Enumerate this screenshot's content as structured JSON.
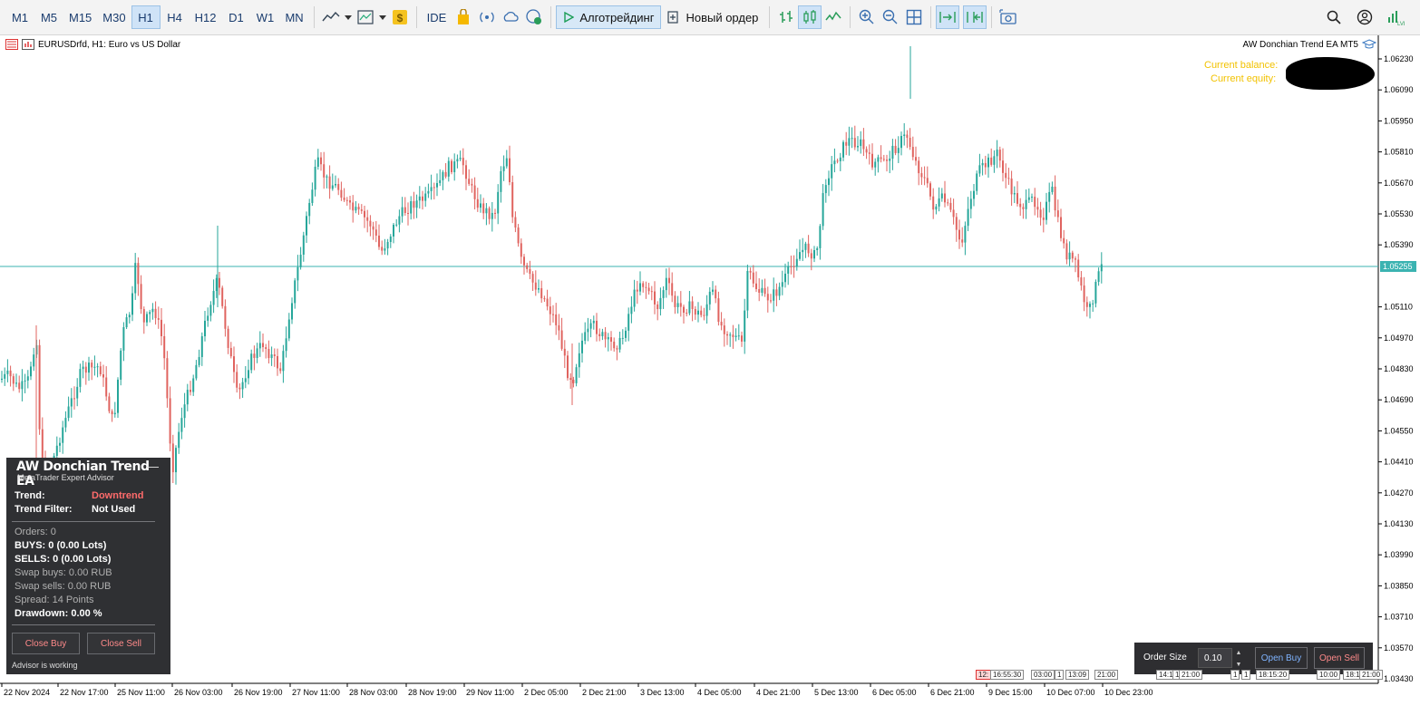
{
  "toolbar": {
    "timeframes": [
      "M1",
      "M5",
      "M15",
      "M30",
      "H1",
      "H4",
      "H12",
      "D1",
      "W1",
      "MN"
    ],
    "active_timeframe": "H1",
    "ide_label": "IDE",
    "algotrading_label": "Алготрейдинг",
    "new_order_label": "Новый ордер"
  },
  "chart": {
    "title": "EURUSDrfd, H1:  Euro vs US Dollar",
    "ea_name": "AW Donchian Trend EA MT5",
    "current_price": "1.05255",
    "price_labels": [
      "1.06230",
      "1.06090",
      "1.05950",
      "1.05810",
      "1.05670",
      "1.05530",
      "1.05390",
      "1.05110",
      "1.04970",
      "1.04830",
      "1.04690",
      "1.04550",
      "1.04410",
      "1.04270",
      "1.04130",
      "1.03990",
      "1.03850",
      "1.03710",
      "1.03570",
      "1.03430"
    ],
    "time_labels": [
      "22 Nov 2024",
      "22 Nov 17:00",
      "25 Nov 11:00",
      "26 Nov 03:00",
      "26 Nov 19:00",
      "27 Nov 11:00",
      "28 Nov 03:00",
      "28 Nov 19:00",
      "29 Nov 11:00",
      "2 Dec 05:00",
      "2 Dec 21:00",
      "3 Dec 13:00",
      "4 Dec 05:00",
      "4 Dec 21:00",
      "5 Dec 13:00",
      "6 Dec 05:00",
      "6 Dec 21:00",
      "9 Dec 15:00",
      "10 Dec 07:00",
      "10 Dec 23:00"
    ],
    "bull_color": "#26a69a",
    "bear_color": "#e0635f",
    "price_line_color": "#3bb3b1"
  },
  "account": {
    "balance_label": "Current balance:",
    "equity_label": "Current equity:"
  },
  "ea_panel": {
    "title": "AW Donchian Trend EA",
    "subtitle": "MetaTrader Expert Advisor",
    "trend_label": "Trend:",
    "trend_value": "Downtrend",
    "trend_value_color": "#ff6b6b",
    "filter_label": "Trend Filter:",
    "filter_value": "Not Used",
    "orders": "Orders: 0",
    "buys": "BUYS: 0 (0.00 Lots)",
    "sells": "SELLS: 0 (0.00 Lots)",
    "swap_buys": "Swap buys: 0.00 RUB",
    "swap_sells": "Swap sells: 0.00 RUB",
    "spread": "Spread: 14 Points",
    "drawdown": "Drawdown: 0.00 %",
    "close_buy_label": "Close Buy",
    "close_sell_label": "Close Sell",
    "status": "Advisor is working"
  },
  "order_panel": {
    "label": "Order Size",
    "value": "0.10",
    "open_buy_label": "Open Buy",
    "open_sell_label": "Open Sell"
  },
  "time_boxes": [
    "12:",
    "16:55:30",
    "03:00",
    "1",
    "13:09",
    "21:00",
    "14:1",
    "1",
    "21:00",
    "1",
    "1",
    "18:15:20",
    "10:00",
    "18:15",
    "21:00"
  ]
}
